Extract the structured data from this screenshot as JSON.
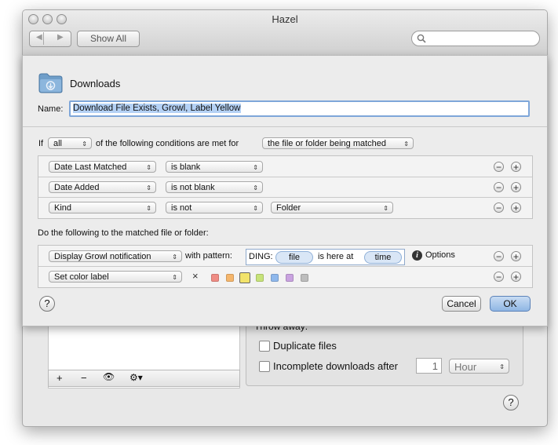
{
  "window": {
    "title": "Hazel",
    "show_all_label": "Show All",
    "search_placeholder": ""
  },
  "background": {
    "ghost_items": [
      "",
      ""
    ],
    "throw_away_label": "Throw away:",
    "duplicate_files_label": "Duplicate files",
    "incomplete_downloads_label": "Incomplete downloads after",
    "incomplete_value": "1",
    "incomplete_unit": "Hour",
    "list_toolbar": {
      "add": "+",
      "remove": "−",
      "eye": "👁",
      "gear": "⚙▾"
    },
    "help": "?"
  },
  "sheet": {
    "folder_name": "Downloads",
    "name_label": "Name:",
    "name_value": "Download File Exists, Growl, Label Yellow",
    "if_label": "If",
    "match_mode": "all",
    "conditions_text": "of the following conditions are met for",
    "target": "the file or folder being matched",
    "conditions": [
      {
        "attribute": "Date Last Matched",
        "operator": "is blank",
        "value": ""
      },
      {
        "attribute": "Date Added",
        "operator": "is not blank",
        "value": ""
      },
      {
        "attribute": "Kind",
        "operator": "is not",
        "value": "Folder"
      }
    ],
    "do_label": "Do the following to the matched file or folder:",
    "actions": {
      "growl": {
        "action": "Display Growl notification",
        "with_pattern_label": "with pattern:",
        "pattern_prefix": "DING:",
        "token_file": "file",
        "pattern_middle": "is here at",
        "token_time": "time",
        "options_label": "Options"
      },
      "color": {
        "action": "Set color label",
        "clear": "×"
      }
    },
    "color_labels": [
      "#ef8c84",
      "#f5b66c",
      "#f2e36a",
      "#c7e37a",
      "#8fb8ec",
      "#c9a3e0",
      "#bdbdbd"
    ],
    "selected_color": "#f2e36a",
    "help": "?",
    "cancel_label": "Cancel",
    "ok_label": "OK",
    "plus": "+",
    "minus": "−"
  }
}
